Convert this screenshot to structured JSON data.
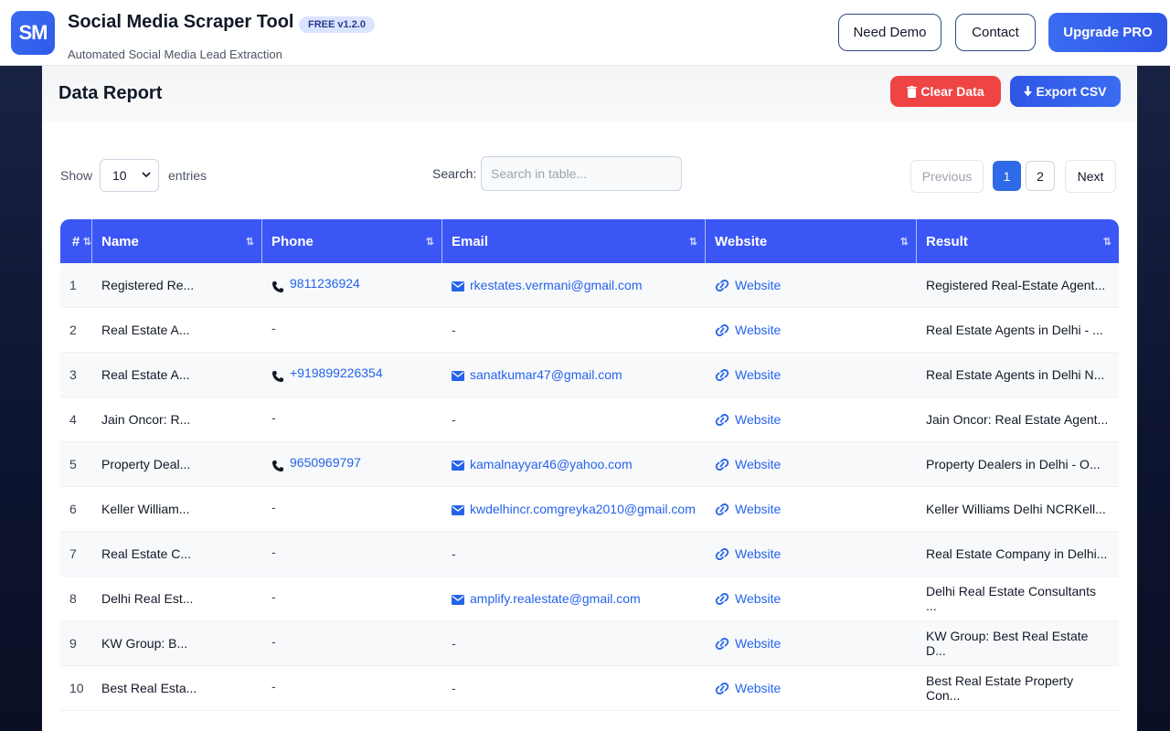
{
  "header": {
    "logo_text": "SM",
    "title": "Social Media Scraper Tool",
    "version": "FREE v1.2.0",
    "subtitle": "Automated Social Media Lead Extraction",
    "need_demo": "Need Demo",
    "contact": "Contact",
    "upgrade": "Upgrade PRO"
  },
  "report": {
    "title": "Data Report",
    "clear_label": "Clear Data",
    "export_label": "Export CSV"
  },
  "controls": {
    "show_label": "Show",
    "entries_value": "10",
    "entries_label": "entries",
    "search_label": "Search:",
    "search_placeholder": "Search in table...",
    "prev_label": "Previous",
    "pages": [
      "1",
      "2"
    ],
    "next_label": "Next"
  },
  "table": {
    "columns": [
      "#",
      "Name",
      "Phone",
      "Email",
      "Website",
      "Result"
    ],
    "rows": [
      {
        "idx": "1",
        "name": "Registered Re...",
        "phone": "9811236924",
        "email": "rkestates.vermani@gmail.com",
        "website": "Website",
        "result": "Registered Real-Estate Agent..."
      },
      {
        "idx": "2",
        "name": "Real Estate A...",
        "phone": "-",
        "email": "-",
        "website": "Website",
        "result": "Real Estate Agents in Delhi - ..."
      },
      {
        "idx": "3",
        "name": "Real Estate A...",
        "phone": "+919899226354",
        "email": "sanatkumar47@gmail.com",
        "website": "Website",
        "result": "Real Estate Agents in Delhi N..."
      },
      {
        "idx": "4",
        "name": "Jain Oncor: R...",
        "phone": "-",
        "email": "-",
        "website": "Website",
        "result": "Jain Oncor: Real Estate Agent..."
      },
      {
        "idx": "5",
        "name": "Property Deal...",
        "phone": "9650969797",
        "email": "kamalnayyar46@yahoo.com",
        "website": "Website",
        "result": "Property Dealers in Delhi - O..."
      },
      {
        "idx": "6",
        "name": "Keller William...",
        "phone": "-",
        "email": "kwdelhincr.comgreyka2010@gmail.com",
        "website": "Website",
        "result": "Keller Williams Delhi NCRKell..."
      },
      {
        "idx": "7",
        "name": "Real Estate C...",
        "phone": "-",
        "email": "-",
        "website": "Website",
        "result": "Real Estate Company in Delhi..."
      },
      {
        "idx": "8",
        "name": "Delhi Real Est...",
        "phone": "-",
        "email": "amplify.realestate@gmail.com",
        "website": "Website",
        "result": "Delhi Real Estate Consultants ..."
      },
      {
        "idx": "9",
        "name": "KW Group: B...",
        "phone": "-",
        "email": "-",
        "website": "Website",
        "result": "KW Group: Best Real Estate D..."
      },
      {
        "idx": "10",
        "name": "Best Real Esta...",
        "phone": "-",
        "email": "-",
        "website": "Website",
        "result": "Best Real Estate Property Con..."
      }
    ]
  },
  "icons": {
    "phone": "phone-icon",
    "email": "envelope-icon",
    "website": "link-icon",
    "clear": "trash-icon",
    "export": "download-icon"
  },
  "colors": {
    "brand": "#3b6cf2",
    "table_header": "#3b56f5",
    "danger": "#ef4444",
    "link": "#2563eb"
  }
}
